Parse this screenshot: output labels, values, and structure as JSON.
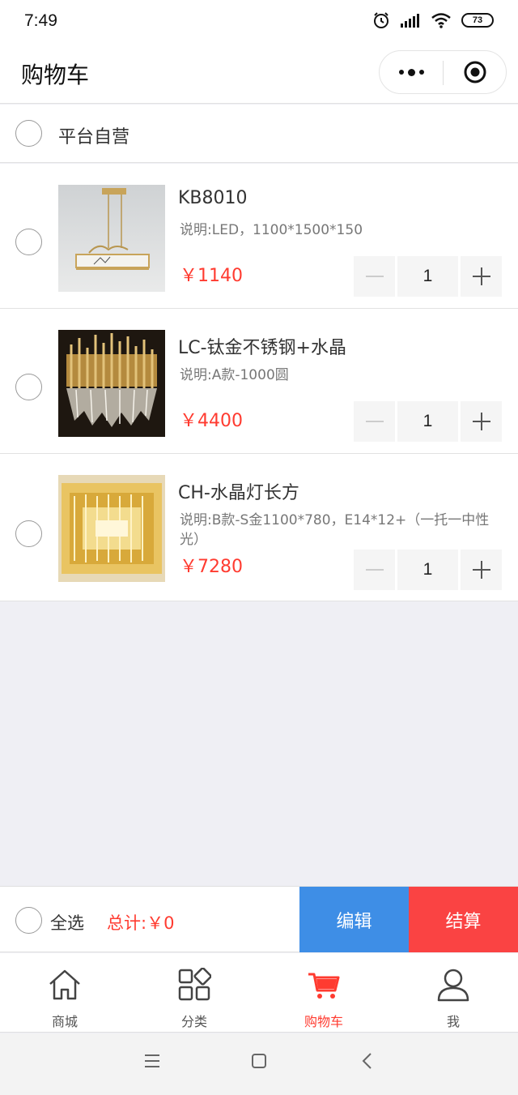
{
  "status_bar": {
    "time": "7:49",
    "battery": "73"
  },
  "nav": {
    "title": "购物车"
  },
  "shop": {
    "name": "平台自营"
  },
  "items": [
    {
      "name": "KB8010",
      "desc": "说明:LED，1100*1500*150",
      "price": "￥1140",
      "qty": "1"
    },
    {
      "name": "LC-钛金不锈钢+水晶",
      "desc": "说明:A款-1000圆",
      "price": "￥4400",
      "qty": "1"
    },
    {
      "name": "CH-水晶灯长方",
      "desc": "说明:B款-S金1100*780，E14*12+（一托一中性光）",
      "price": "￥7280",
      "qty": "1"
    }
  ],
  "footer": {
    "select_all": "全选",
    "total": "总计:￥0",
    "edit": "编辑",
    "checkout": "结算"
  },
  "tabs": [
    {
      "label": "商城",
      "icon": "home-icon"
    },
    {
      "label": "分类",
      "icon": "category-icon"
    },
    {
      "label": "购物车",
      "icon": "cart-icon"
    },
    {
      "label": "我",
      "icon": "user-icon"
    }
  ],
  "colors": {
    "accent_red": "#ff3b30",
    "edit_blue": "#3e8ee6",
    "checkout_red": "#fa4343"
  }
}
